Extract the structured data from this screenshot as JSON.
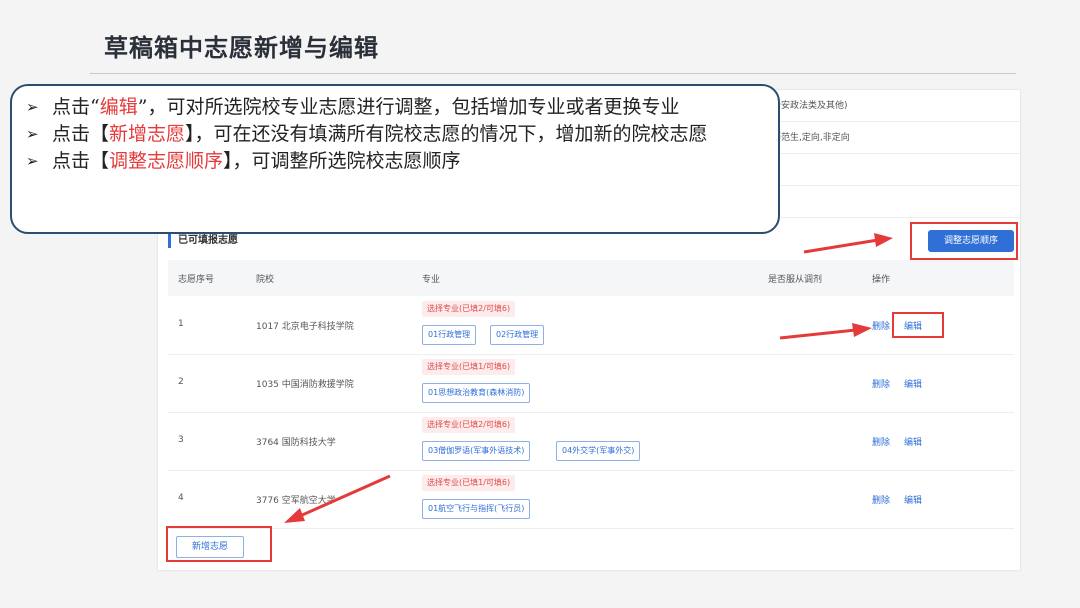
{
  "slide": {
    "title": "草稿箱中志愿新增与编辑"
  },
  "callout": {
    "bullets": [
      {
        "prefix": "点击“",
        "highlight": "编辑",
        "suffix": "”，可对所选院校专业志愿进行调整，包括增加专业或者更换专业"
      },
      {
        "prefix": "点击【",
        "highlight": "新增志愿",
        "suffix": "】，可在还没有填满所有院校志愿的情况下，增加新的院校志愿"
      },
      {
        "prefix": "点击【",
        "highlight": "调整志愿顺序",
        "suffix": "】，可调整所选院校志愿顺序"
      }
    ]
  },
  "form_partial": {
    "row1": "公安政法类及其他)",
    "row2": "师范生,定向,非定向"
  },
  "section": {
    "title": "已可填报志愿",
    "adjust_button": "调整志愿顺序"
  },
  "table": {
    "headers": {
      "order": "志愿序号",
      "school": "院校",
      "major": "专业",
      "obey": "是否服从调剂",
      "action": "操作"
    },
    "rows": [
      {
        "order": "1",
        "school": "1017 北京电子科技学院",
        "pick": "选择专业(已填2/可填6)",
        "majors": [
          "01行政管理",
          "02行政管理"
        ],
        "delete": "删除",
        "edit": "编辑"
      },
      {
        "order": "2",
        "school": "1035 中国消防救援学院",
        "pick": "选择专业(已填1/可填6)",
        "majors": [
          "01思想政治教育(森林消防)"
        ],
        "delete": "删除",
        "edit": "编辑"
      },
      {
        "order": "3",
        "school": "3764 国防科技大学",
        "pick": "选择专业(已填2/可填6)",
        "majors": [
          "03僧伽罗语(军事外语技术)",
          "04外交学(军事外交)"
        ],
        "delete": "删除",
        "edit": "编辑"
      },
      {
        "order": "4",
        "school": "3776 空军航空大学",
        "pick": "选择专业(已填1/可填6)",
        "majors": [
          "01航空飞行与指挥(飞行员)"
        ],
        "delete": "删除",
        "edit": "编辑"
      }
    ]
  },
  "add_button": "新增志愿",
  "colors": {
    "accent": "#2f6fd6",
    "highlight_red": "#e53a3a",
    "callout_border": "#2b4d6e"
  },
  "icons": {
    "bullet": "right-triangle-arrow-icon"
  }
}
